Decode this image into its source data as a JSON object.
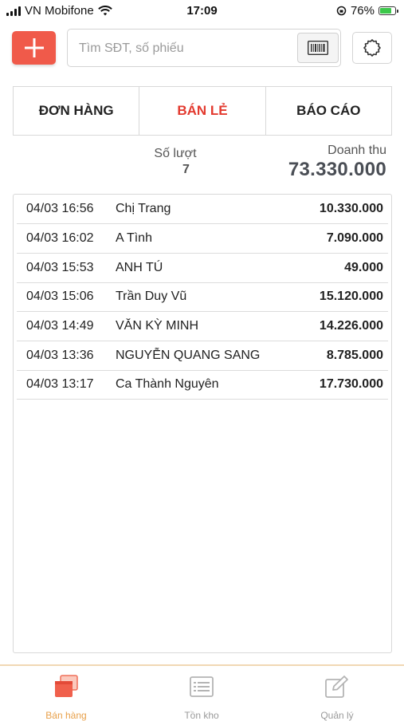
{
  "status_bar": {
    "carrier": "VN Mobifone",
    "time": "17:09",
    "battery": "76%",
    "battery_level": 0.76
  },
  "search": {
    "placeholder": "Tìm SĐT, số phiếu"
  },
  "tabs": [
    {
      "label": "ĐƠN HÀNG",
      "active": false
    },
    {
      "label": "BÁN LẺ",
      "active": true
    },
    {
      "label": "BÁO CÁO",
      "active": false
    }
  ],
  "stats": {
    "count_label": "Số lượt",
    "count_value": "7",
    "revenue_label": "Doanh thu",
    "revenue_value": "73.330.000"
  },
  "orders": [
    {
      "time": "04/03 16:56",
      "name": "Chị Trang",
      "amount": "10.330.000"
    },
    {
      "time": "04/03 16:02",
      "name": "A Tình",
      "amount": "7.090.000"
    },
    {
      "time": "04/03 15:53",
      "name": "ANH TÚ",
      "amount": "49.000"
    },
    {
      "time": "04/03 15:06",
      "name": "Trần Duy Vũ",
      "amount": "15.120.000"
    },
    {
      "time": "04/03 14:49",
      "name": "VĂN KỲ MINH",
      "amount": "14.226.000"
    },
    {
      "time": "04/03 13:36",
      "name": "NGUYỄN QUANG SANG",
      "amount": "8.785.000"
    },
    {
      "time": "04/03 13:17",
      "name": "Ca Thành Nguyên",
      "amount": "17.730.000"
    }
  ],
  "bottom_nav": [
    {
      "label": "Bán hàng",
      "icon": "stacked-windows-icon",
      "active": true
    },
    {
      "label": "Tồn kho",
      "icon": "list-icon",
      "active": false
    },
    {
      "label": "Quản lý",
      "icon": "edit-icon",
      "active": false
    }
  ],
  "colors": {
    "accent": "#f05a4a",
    "active_tab": "#e33a2f",
    "nav_active": "#e8a04a"
  }
}
